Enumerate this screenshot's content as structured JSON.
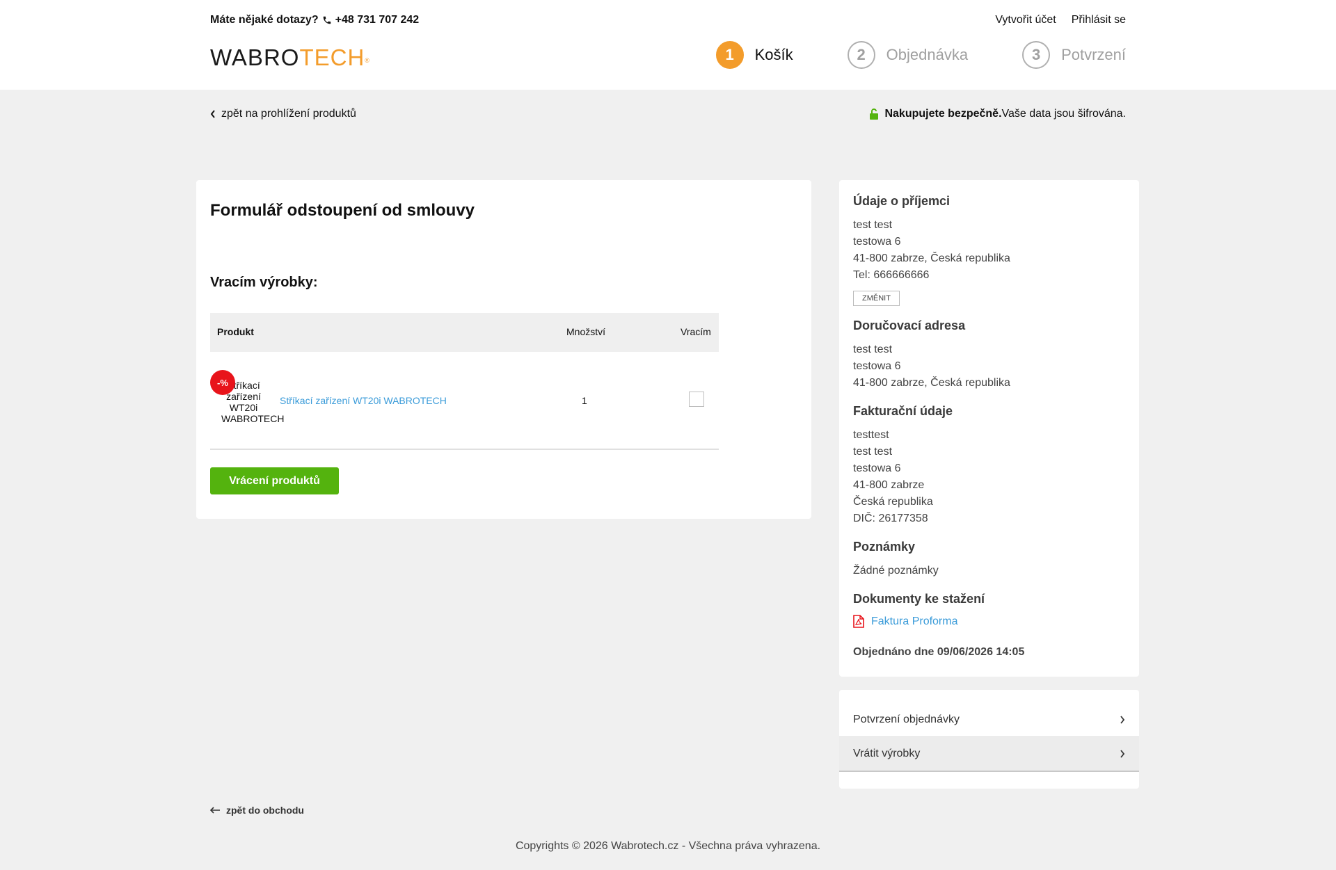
{
  "header": {
    "contact_question": "Máte nějaké dotazy?",
    "phone": "+48 731 707 242",
    "create_account": "Vytvořit účet",
    "login": "Přihlásit se",
    "logo_part1": "WABRO",
    "logo_part2": "TECH",
    "logo_mark": "®"
  },
  "steps": [
    {
      "num": "1",
      "label": "Košík",
      "active": true
    },
    {
      "num": "2",
      "label": "Objednávka",
      "active": false
    },
    {
      "num": "3",
      "label": "Potvrzení",
      "active": false
    }
  ],
  "subheader": {
    "back_label": "zpět na prohlížení produktů",
    "secure_bold": "Nakupujete bezpečně.",
    "secure_text": "Vaše data jsou šifrována."
  },
  "main": {
    "title": "Formulář odstoupení od smlouvy",
    "subtitle": "Vracím výrobky:",
    "table": {
      "headers": {
        "product": "Produkt",
        "qty": "Množství",
        "returning": "Vracím"
      },
      "rows": [
        {
          "badge": "-%",
          "img_alt": "Stříkací zařízení WT20i WABROTECH",
          "name": "Stříkací zařízení WT20i WABROTECH",
          "qty": "1",
          "checked": false
        }
      ]
    },
    "submit_label": "Vrácení produktů"
  },
  "sidebar": {
    "recipient": {
      "title": "Údaje o příjemci",
      "lines": [
        "test test",
        "testowa 6",
        "41-800 zabrze, Česká republika",
        "Tel: 666666666"
      ],
      "change_label": "ZMĚNIT"
    },
    "delivery": {
      "title": "Doručovací adresa",
      "lines": [
        "test test",
        "testowa 6",
        "41-800 zabrze, Česká republika"
      ]
    },
    "billing": {
      "title": "Fakturační údaje",
      "lines": [
        "testtest",
        "test test",
        "testowa 6",
        "41-800 zabrze",
        "Česká republika",
        "DIČ: 26177358"
      ]
    },
    "notes": {
      "title": "Poznámky",
      "text": "Žádné poznámky"
    },
    "documents": {
      "title": "Dokumenty ke stažení",
      "link": "Faktura Proforma"
    },
    "ordered": "Objednáno dne 09/06/2026 14:05"
  },
  "nav": {
    "items": [
      {
        "label": "Potvrzení objednávky",
        "active": false
      },
      {
        "label": "Vrátit výrobky",
        "active": true
      }
    ]
  },
  "footer": {
    "back_shop": "zpět do obchodu",
    "copyright": "Copyrights © 2026 Wabrotech.cz - Všechna práva vyhrazena."
  },
  "colors": {
    "accent": "#f39c2b",
    "green": "#54b30e",
    "link": "#3a9bd9",
    "badge": "#e8141b",
    "lock": "#54b30e",
    "pdf": "#e8141b"
  },
  "icons": {
    "phone": "phone-icon",
    "back": "chevron-left-icon",
    "lock": "lock-open-icon",
    "pdf": "pdf-icon",
    "nav_arrow": "chevron-right-icon",
    "back_shop": "arrow-left-icon"
  }
}
